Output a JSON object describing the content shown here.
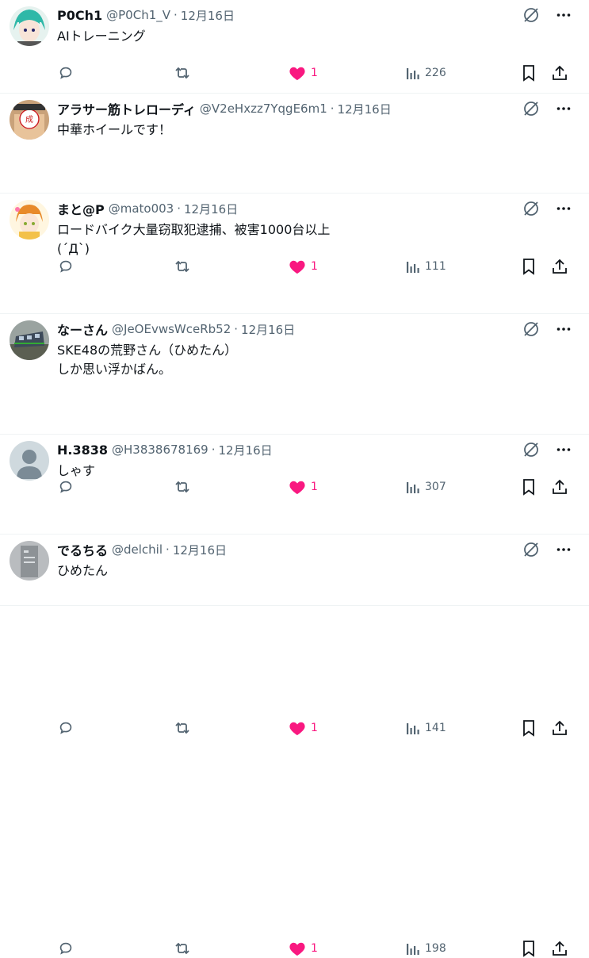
{
  "posts": [
    {
      "name": "P0Ch1",
      "handle": "@P0Ch1_V",
      "time": "12月16日",
      "text": [
        "AIトレーニング"
      ],
      "likes": "1",
      "views": "226",
      "avatar": "anime-green"
    },
    {
      "name": "アラサー筋トレローディ",
      "handle": "@V2eHxzz7YqgE6m1",
      "time": "12月16日",
      "text": [
        "中華ホイールです！"
      ],
      "likes": "1",
      "views": "111",
      "avatar": "person-sign"
    },
    {
      "name": "まと@P",
      "handle": "@mato003",
      "time": "12月16日",
      "text": [
        "ロードバイク大量窃取犯逮捕、被害1000台以上",
        "(´Д`)"
      ],
      "likes": "1",
      "views": "307",
      "avatar": "anime-orange"
    },
    {
      "name": "なーさん",
      "handle": "@JeOEvwsWceRb52",
      "time": "12月16日",
      "text": [
        "SKE48の荒野さん（ひめたん）",
        "しか思い浮かばん。"
      ],
      "likes": "1",
      "views": "141",
      "avatar": "train"
    },
    {
      "name": "H.3838",
      "handle": "@H3838678169",
      "time": "12月16日",
      "text": [
        "しゃす"
      ],
      "likes": "1",
      "views": "198",
      "avatar": "default"
    },
    {
      "name": "でるちる",
      "handle": "@delchil",
      "time": "12月16日",
      "text": [
        "ひめたん"
      ],
      "likes": "",
      "views": "",
      "avatar": "photo-gray"
    }
  ],
  "separator": "·",
  "colors": {
    "text": "#0f1419",
    "muted": "#536471",
    "like": "#f91880",
    "border": "#eff3f4"
  },
  "icons": [
    "reply-icon",
    "retweet-icon",
    "heart-icon",
    "views-icon",
    "bookmark-icon",
    "share-icon",
    "grok-icon",
    "more-icon"
  ]
}
